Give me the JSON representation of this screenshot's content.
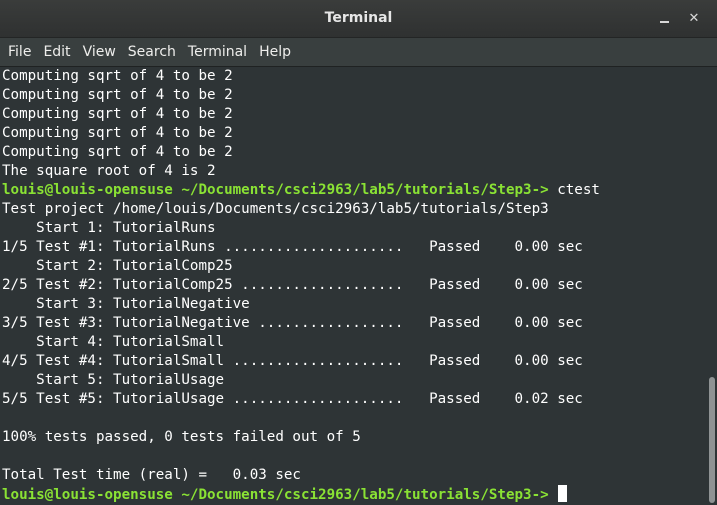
{
  "window": {
    "title": "Terminal",
    "minimize_glyph": "",
    "close_glyph": "✕"
  },
  "menu": [
    "File",
    "Edit",
    "View",
    "Search",
    "Terminal",
    "Help"
  ],
  "prompt": "louis@louis-opensuse ~/Documents/csci2963/lab5/tutorials/Step3->",
  "lines": [
    {
      "text": "Computing sqrt of 4 to be 2"
    },
    {
      "text": "Computing sqrt of 4 to be 2"
    },
    {
      "text": "Computing sqrt of 4 to be 2"
    },
    {
      "text": "Computing sqrt of 4 to be 2"
    },
    {
      "text": "Computing sqrt of 4 to be 2"
    },
    {
      "text": "The square root of 4 is 2"
    },
    {
      "prompt": true,
      "cmd": " ctest"
    },
    {
      "text": "Test project /home/louis/Documents/csci2963/lab5/tutorials/Step3"
    },
    {
      "text": "    Start 1: TutorialRuns"
    },
    {
      "text": "1/5 Test #1: TutorialRuns .....................   Passed    0.00 sec"
    },
    {
      "text": "    Start 2: TutorialComp25"
    },
    {
      "text": "2/5 Test #2: TutorialComp25 ...................   Passed    0.00 sec"
    },
    {
      "text": "    Start 3: TutorialNegative"
    },
    {
      "text": "3/5 Test #3: TutorialNegative .................   Passed    0.00 sec"
    },
    {
      "text": "    Start 4: TutorialSmall"
    },
    {
      "text": "4/5 Test #4: TutorialSmall ....................   Passed    0.00 sec"
    },
    {
      "text": "    Start 5: TutorialUsage"
    },
    {
      "text": "5/5 Test #5: TutorialUsage ....................   Passed    0.02 sec"
    },
    {
      "text": ""
    },
    {
      "text": "100% tests passed, 0 tests failed out of 5"
    },
    {
      "text": ""
    },
    {
      "text": "Total Test time (real) =   0.03 sec"
    },
    {
      "prompt": true,
      "cmd": " ",
      "cursor": true
    }
  ],
  "colors": {
    "prompt": "#8ae234",
    "background": "#2e3436",
    "foreground": "#ffffff"
  }
}
